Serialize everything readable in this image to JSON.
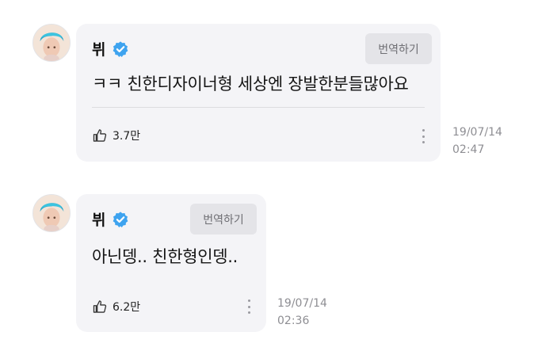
{
  "comments": [
    {
      "author": "뷔",
      "verified": true,
      "translate_label": "번역하기",
      "text": "ㅋㅋ 친한디자이너형 세상엔 장발한분들많아요",
      "likes": "3.7만",
      "date": "19/07/14",
      "time": "02:47"
    },
    {
      "author": "뷔",
      "verified": true,
      "translate_label": "번역하기",
      "text": "아닌뎅.. 친한형인뎅..",
      "likes": "6.2만",
      "date": "19/07/14",
      "time": "02:36"
    }
  ],
  "colors": {
    "bubble": "#f4f4f7",
    "verified_badge": "#3ea3ef",
    "translate_bg": "#e4e4e8",
    "timestamp": "#8e8e93"
  },
  "icons": [
    "avatar",
    "verified-badge-icon",
    "thumbs-up-icon",
    "more-options-icon"
  ]
}
